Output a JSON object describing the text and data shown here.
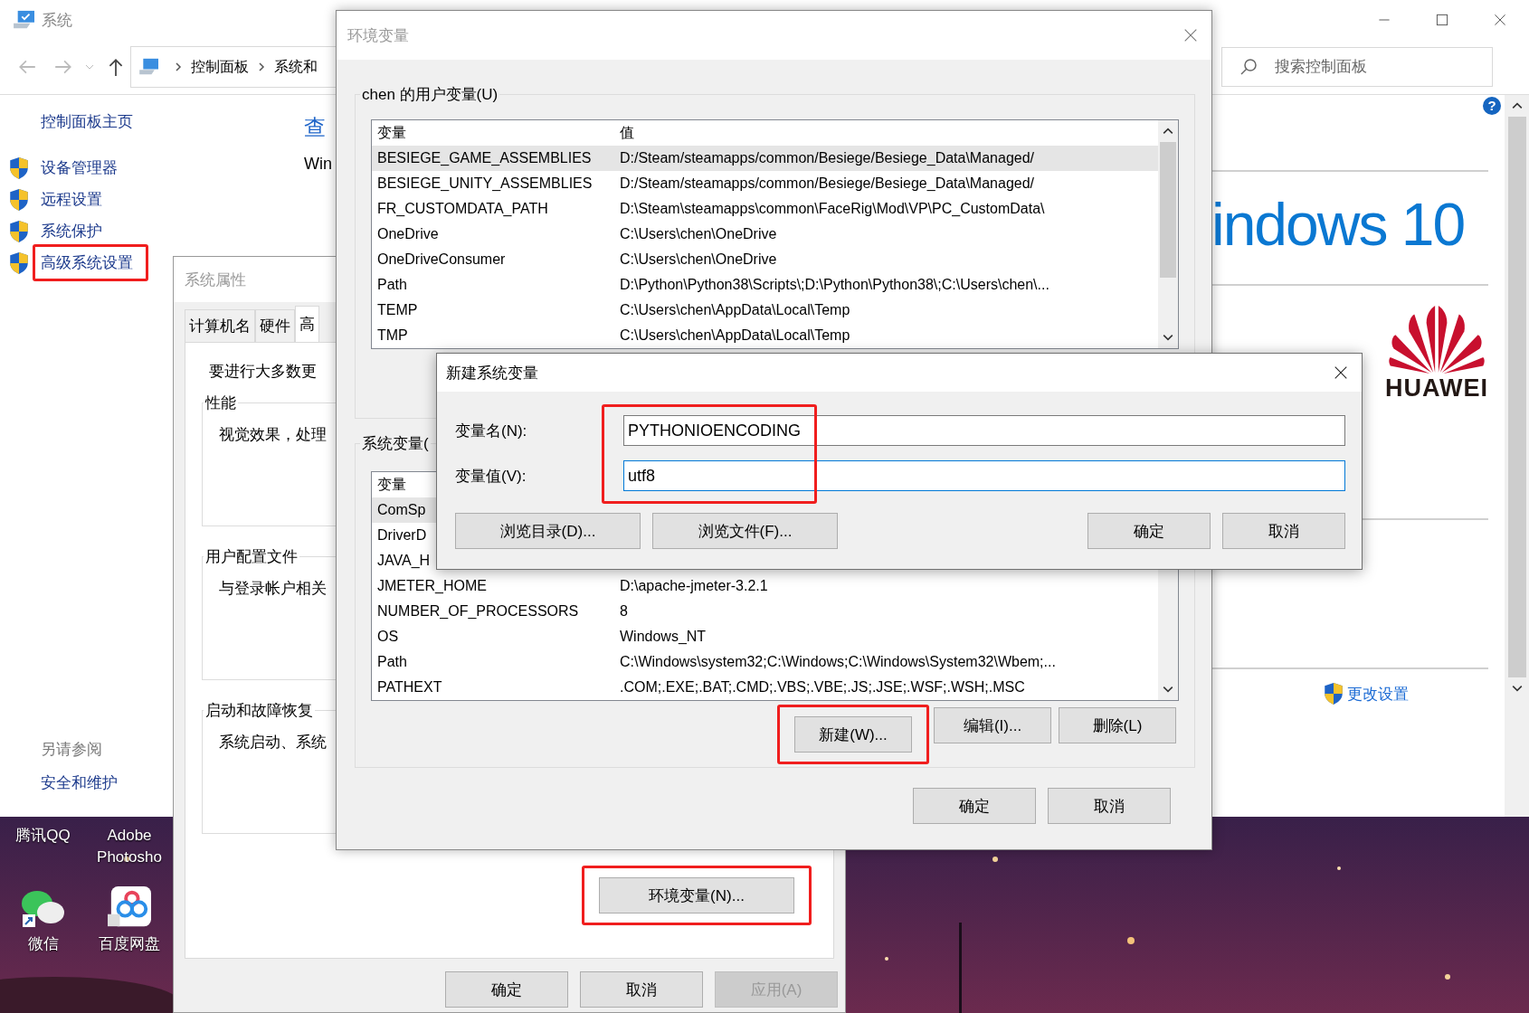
{
  "control_panel": {
    "title": "系统",
    "breadcrumb": [
      "控制面板",
      "系统和"
    ],
    "search": {
      "placeholder": "搜索控制面板"
    },
    "sidebar": {
      "home": "控制面板主页",
      "items": [
        {
          "label": "设备管理器",
          "highlighted": false
        },
        {
          "label": "远程设置",
          "highlighted": false
        },
        {
          "label": "系统保护",
          "highlighted": false
        },
        {
          "label": "高级系统设置",
          "highlighted": true
        }
      ],
      "see_also_title": "另请参阅",
      "see_also": [
        "安全和维护"
      ]
    },
    "heading": "查",
    "edition": "Win",
    "help": "?",
    "logo_text": "indows 10",
    "oem_logo": "HUAWEI",
    "change_settings": "更改设置"
  },
  "system_properties": {
    "title": "系统属性",
    "tabs": [
      {
        "label": "计算机名",
        "selected": false
      },
      {
        "label": "硬件",
        "selected": false
      },
      {
        "label": "高",
        "selected": true
      }
    ],
    "note": "要进行大多数更",
    "groups": [
      {
        "title": "性能",
        "text": "视觉效果，处理"
      },
      {
        "title": "用户配置文件",
        "text": "与登录帐户相关"
      },
      {
        "title": "启动和故障恢复",
        "text": "系统启动、系统"
      }
    ],
    "env_button": {
      "label": "环境变量(N)...",
      "highlighted": true
    },
    "buttons": [
      {
        "label": "确定",
        "disabled": false
      },
      {
        "label": "取消",
        "disabled": false
      },
      {
        "label": "应用(A)",
        "disabled": true
      }
    ]
  },
  "environment_variables": {
    "title": "环境变量",
    "user_group": "chen 的用户变量(U)",
    "user_table": {
      "columns": [
        "变量",
        "值"
      ],
      "rows": [
        {
          "name": "BESIEGE_GAME_ASSEMBLIES",
          "value": "D:/Steam/steamapps/common/Besiege/Besiege_Data\\Managed/",
          "selected": true
        },
        {
          "name": "BESIEGE_UNITY_ASSEMBLIES",
          "value": "D:/Steam/steamapps/common/Besiege/Besiege_Data\\Managed/",
          "selected": false
        },
        {
          "name": "FR_CUSTOMDATA_PATH",
          "value": "D:\\Steam\\steamapps\\common\\FaceRig\\Mod\\VP\\PC_CustomData\\",
          "selected": false
        },
        {
          "name": "OneDrive",
          "value": "C:\\Users\\chen\\OneDrive",
          "selected": false
        },
        {
          "name": "OneDriveConsumer",
          "value": "C:\\Users\\chen\\OneDrive",
          "selected": false
        },
        {
          "name": "Path",
          "value": "D:\\Python\\Python38\\Scripts\\;D:\\Python\\Python38\\;C:\\Users\\chen\\...",
          "selected": false
        },
        {
          "name": "TEMP",
          "value": "C:\\Users\\chen\\AppData\\Local\\Temp",
          "selected": false
        },
        {
          "name": "TMP",
          "value": "C:\\Users\\chen\\AppData\\Local\\Temp",
          "selected": false
        }
      ]
    },
    "system_group": "系统变量(",
    "system_table": {
      "columns": [
        "变量"
      ],
      "rows": [
        {
          "name": "ComSp",
          "selected": true
        },
        {
          "name": "DriverD",
          "selected": false
        },
        {
          "name": "JAVA_H",
          "selected": false
        },
        {
          "name": "JMETER_HOME",
          "value": "D:\\apache-jmeter-3.2.1",
          "selected": false
        },
        {
          "name": "NUMBER_OF_PROCESSORS",
          "value": "8",
          "selected": false
        },
        {
          "name": "OS",
          "value": "Windows_NT",
          "selected": false
        },
        {
          "name": "Path",
          "value": "C:\\Windows\\system32;C:\\Windows;C:\\Windows\\System32\\Wbem;...",
          "selected": false
        },
        {
          "name": "PATHEXT",
          "value": ".COM;.EXE;.BAT;.CMD;.VBS;.VBE;.JS;.JSE;.WSF;.WSH;.MSC",
          "selected": false
        }
      ]
    },
    "system_buttons": [
      {
        "label": "新建(W)...",
        "highlighted": true
      },
      {
        "label": "编辑(I)...",
        "highlighted": false
      },
      {
        "label": "删除(L)",
        "highlighted": false
      }
    ],
    "buttons": [
      "确定",
      "取消"
    ]
  },
  "new_variable": {
    "title": "新建系统变量",
    "highlighted": true,
    "fields": [
      {
        "label": "变量名(N):",
        "value": "PYTHONIOENCODING",
        "focused": false
      },
      {
        "label": "变量值(V):",
        "value": "utf8",
        "focused": true
      }
    ],
    "browse_buttons": [
      "浏览目录(D)...",
      "浏览文件(F)..."
    ],
    "buttons": [
      "确定",
      "取消"
    ]
  },
  "desktop": {
    "icons": [
      {
        "label": "腾讯QQ",
        "kind": "covered"
      },
      {
        "label": "Adobe Photosho",
        "kind": "covered"
      },
      {
        "label": "微信",
        "kind": "chat"
      },
      {
        "label": "百度网盘",
        "kind": "cloud"
      }
    ]
  }
}
